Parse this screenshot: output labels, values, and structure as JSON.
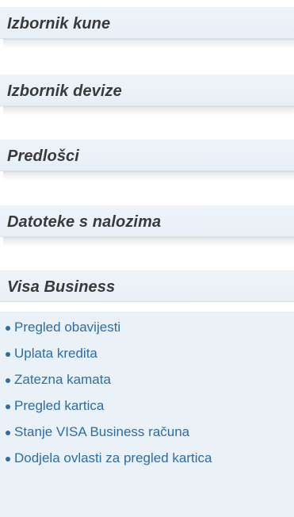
{
  "menu": {
    "sections": [
      {
        "title": "Izbornik kune"
      },
      {
        "title": "Izbornik devize"
      },
      {
        "title": "Predlošci"
      },
      {
        "title": "Datoteke s nalozima"
      },
      {
        "title": "Visa Business"
      }
    ],
    "visa_items": [
      {
        "label": "Pregled obavijesti"
      },
      {
        "label": "Uplata kredita"
      },
      {
        "label": "Zatezna kamata"
      },
      {
        "label": "Pregled kartica"
      },
      {
        "label": "Stanje VISA Business računa"
      },
      {
        "label": "Dodjela ovlasti za pregled kartica"
      }
    ]
  },
  "colors": {
    "header_bg": "#e9f0f7",
    "header_text": "#3a3a3a",
    "link": "#2b6da9"
  }
}
